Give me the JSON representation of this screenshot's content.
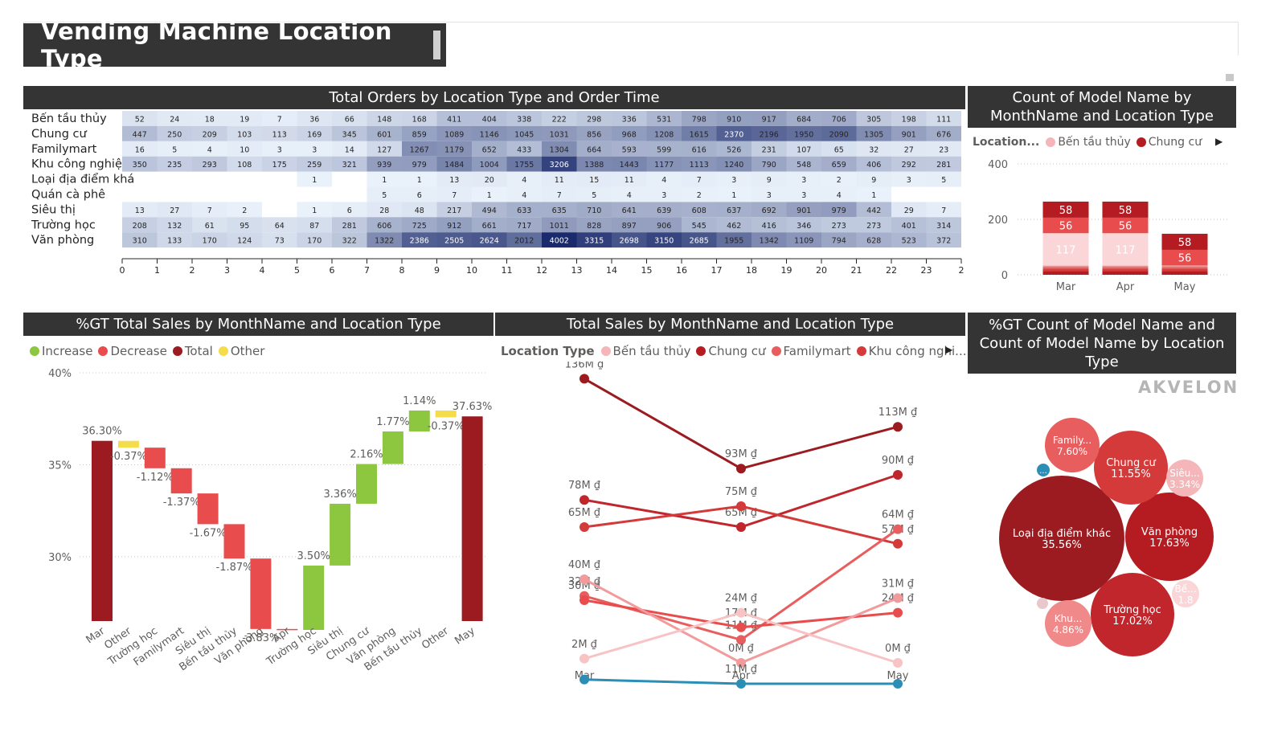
{
  "page": {
    "title": "Vending Machine Location Type",
    "logo": "AKVELON"
  },
  "visuals": {
    "heatmap_title": "Total Orders by Location Type and Order Time",
    "stacked_title": "Count of Model Name by MonthName and Location Type",
    "waterfall_title": "%GT Total Sales by MonthName and Location Type",
    "line_title": "Total Sales by MonthName and Location Type",
    "bubble_title": "%GT Count of Model Name and Count of Model Name by Location Type"
  },
  "colors": {
    "header_bg": "#343434",
    "heat_low": "#eaf2fb",
    "heat_high": "#1a2a6c",
    "increase": "#8dc63f",
    "decrease": "#e84c4c",
    "total": "#9b1b20",
    "other": "#f5dc4a"
  },
  "legends": {
    "stacked": {
      "title": "Location...",
      "items": [
        {
          "label": "Bến tầu thủy",
          "color": "#f4b6b9"
        },
        {
          "label": "Chung cư",
          "color": "#b51c22"
        }
      ]
    },
    "waterfall": {
      "items": [
        {
          "label": "Increase",
          "color": "#8dc63f"
        },
        {
          "label": "Decrease",
          "color": "#e84c4c"
        },
        {
          "label": "Total",
          "color": "#9b1b20"
        },
        {
          "label": "Other",
          "color": "#f5dc4a"
        }
      ]
    },
    "line": {
      "title": "Location Type",
      "items": [
        {
          "label": "Bến tầu thủy",
          "color": "#f4b6b9"
        },
        {
          "label": "Chung cư",
          "color": "#b51c22"
        },
        {
          "label": "Familymart",
          "color": "#e85d5d"
        },
        {
          "label": "Khu công nghi...",
          "color": "#d43a3a"
        }
      ]
    }
  },
  "chart_data": [
    {
      "type": "heatmap",
      "title": "Total Orders by Location Type and Order Time",
      "rows": [
        "Bến tầu thủy",
        "Chung cư",
        "Familymart",
        "Khu công nghiệp",
        "Loại địa điểm khá",
        "Quán cà phê",
        "Siêu thị",
        "Trường học",
        "Văn phòng"
      ],
      "x_ticks": [
        "0",
        "1",
        "2",
        "3",
        "4",
        "5",
        "6",
        "7",
        "8",
        "9",
        "10",
        "11",
        "12",
        "13",
        "14",
        "15",
        "16",
        "17",
        "18",
        "19",
        "20",
        "21",
        "22",
        "23",
        "2"
      ],
      "values": [
        [
          "52",
          "24",
          "18",
          "19",
          "7",
          "36",
          "66",
          "148",
          "168",
          "411",
          "404",
          "338",
          "222",
          "298",
          "336",
          "531",
          "798",
          "910",
          "917",
          "684",
          "706",
          "305",
          "198",
          "111"
        ],
        [
          "447",
          "250",
          "209",
          "103",
          "113",
          "169",
          "345",
          "601",
          "859",
          "1089",
          "1146",
          "1045",
          "1031",
          "856",
          "968",
          "1208",
          "1615",
          "2370",
          "2196",
          "1950",
          "2090",
          "1305",
          "901",
          "676"
        ],
        [
          "16",
          "5",
          "4",
          "10",
          "3",
          "3",
          "14",
          "127",
          "1267",
          "1179",
          "652",
          "433",
          "1304",
          "664",
          "593",
          "599",
          "616",
          "526",
          "231",
          "107",
          "65",
          "32",
          "27",
          "23"
        ],
        [
          "350",
          "235",
          "293",
          "108",
          "175",
          "259",
          "321",
          "939",
          "979",
          "1484",
          "1004",
          "1755",
          "3206",
          "1388",
          "1443",
          "1177",
          "1113",
          "1240",
          "790",
          "548",
          "659",
          "406",
          "292",
          "281"
        ],
        [
          "",
          "",
          "",
          "",
          "",
          "1",
          "",
          "1",
          "1",
          "13",
          "20",
          "4",
          "11",
          "15",
          "11",
          "4",
          "7",
          "3",
          "9",
          "3",
          "2",
          "9",
          "3",
          "5"
        ],
        [
          "",
          "",
          "",
          "",
          "",
          "",
          "",
          "5",
          "6",
          "7",
          "1",
          "4",
          "7",
          "5",
          "4",
          "3",
          "2",
          "1",
          "3",
          "3",
          "4",
          "1",
          "",
          ""
        ],
        [
          "13",
          "27",
          "7",
          "2",
          "",
          "1",
          "6",
          "28",
          "48",
          "217",
          "494",
          "633",
          "635",
          "710",
          "641",
          "639",
          "608",
          "637",
          "692",
          "901",
          "979",
          "442",
          "29",
          "7"
        ],
        [
          "208",
          "132",
          "61",
          "95",
          "64",
          "87",
          "281",
          "606",
          "725",
          "912",
          "661",
          "717",
          "1011",
          "828",
          "897",
          "906",
          "545",
          "462",
          "416",
          "346",
          "273",
          "273",
          "401",
          "314"
        ],
        [
          "310",
          "133",
          "170",
          "124",
          "73",
          "170",
          "322",
          "1322",
          "2386",
          "2505",
          "2624",
          "2012",
          "4002",
          "3315",
          "2698",
          "3150",
          "2685",
          "1955",
          "1342",
          "1109",
          "794",
          "628",
          "523",
          "372"
        ]
      ]
    },
    {
      "type": "bar",
      "stacked": true,
      "title": "Count of Model Name by MonthName and Location Type",
      "categories": [
        "Mar",
        "Apr",
        "May"
      ],
      "y_ticks": [
        "0",
        "200",
        "400"
      ],
      "ylim": [
        0,
        400
      ],
      "series": [
        {
          "color": "#b51c22",
          "values": [
            14,
            14,
            14
          ],
          "labels": [
            "",
            "",
            ""
          ]
        },
        {
          "color": "#d43a3a",
          "values": [
            7,
            7,
            7
          ],
          "labels": [
            "",
            "",
            ""
          ]
        },
        {
          "color": "#e84c4c",
          "values": [
            6,
            6,
            6
          ],
          "labels": [
            "",
            "",
            ""
          ]
        },
        {
          "color": "#f08a8a",
          "values": [
            6,
            6,
            7
          ],
          "labels": [
            "",
            "",
            ""
          ]
        },
        {
          "color": "#fad6d8",
          "values": [
            117,
            117,
            0
          ],
          "labels": [
            "117",
            "117",
            ""
          ]
        },
        {
          "color": "#e84c4c",
          "values": [
            56,
            56,
            56
          ],
          "labels": [
            "56",
            "56",
            "56"
          ]
        },
        {
          "color": "#b51c22",
          "values": [
            58,
            58,
            58
          ],
          "labels": [
            "58",
            "58",
            "58"
          ]
        }
      ]
    },
    {
      "type": "bar",
      "subtype": "waterfall",
      "title": "%GT Total Sales by MonthName and Location Type",
      "y_ticks": [
        "30%",
        "35%",
        "40%"
      ],
      "ylim": [
        26.5,
        40
      ],
      "steps": [
        {
          "label": "Mar",
          "kind": "total",
          "value": 36.3,
          "text": "36.30%"
        },
        {
          "label": "Other",
          "kind": "other",
          "value": -0.37,
          "text": "-0.37%"
        },
        {
          "label": "Trường học",
          "kind": "decrease",
          "value": -1.12,
          "text": "-1.12%"
        },
        {
          "label": "Familymart",
          "kind": "decrease",
          "value": -1.37,
          "text": "-1.37%"
        },
        {
          "label": "Siêu thị",
          "kind": "decrease",
          "value": -1.67,
          "text": "-1.67%"
        },
        {
          "label": "Bến tầu thủy",
          "kind": "decrease",
          "value": -1.87,
          "text": "-1.87%"
        },
        {
          "label": "Văn phòng",
          "kind": "decrease",
          "value": -3.83,
          "text": "-3.83%"
        },
        {
          "label": "Apr",
          "kind": "decrease",
          "value": -0.05,
          "text": ""
        },
        {
          "label": "Trường học",
          "kind": "increase",
          "value": 3.5,
          "text": "3.50%"
        },
        {
          "label": "Siêu thị",
          "kind": "increase",
          "value": 3.36,
          "text": "3.36%"
        },
        {
          "label": "Chung cư",
          "kind": "increase",
          "value": 2.16,
          "text": "2.16%"
        },
        {
          "label": "Văn phòng",
          "kind": "increase",
          "value": 1.77,
          "text": "1.77%"
        },
        {
          "label": "Bến tầu thủy",
          "kind": "increase",
          "value": 1.14,
          "text": "1.14%"
        },
        {
          "label": "Other",
          "kind": "other",
          "value": -0.37,
          "text": "-0.37%"
        },
        {
          "label": "May",
          "kind": "total",
          "value": 37.63,
          "text": "37.63%"
        }
      ]
    },
    {
      "type": "line",
      "title": "Total Sales by MonthName and Location Type",
      "x": [
        "Mar",
        "Apr",
        "May"
      ],
      "series": [
        {
          "color": "#9b1b20",
          "values": [
            136,
            93,
            113
          ],
          "labels": [
            "136M ₫",
            "93M ₫",
            "113M ₫"
          ]
        },
        {
          "color": "#c0262c",
          "values": [
            78,
            65,
            90
          ],
          "labels": [
            "78M ₫",
            "65M ₫",
            "90M ₫"
          ]
        },
        {
          "color": "#d43a3a",
          "values": [
            65,
            75,
            57
          ],
          "labels": [
            "65M ₫",
            "75M ₫",
            "57M ₫"
          ]
        },
        {
          "color": "#e85d5d",
          "values": [
            32,
            11,
            64
          ],
          "labels": [
            "32M ₫",
            "11M ₫",
            "64M ₫"
          ]
        },
        {
          "color": "#e84c4c",
          "values": [
            30,
            17,
            24
          ],
          "labels": [
            "30M ₫",
            "17M ₫",
            "24M ₫"
          ]
        },
        {
          "color": "#f29a9c",
          "values": [
            40,
            0,
            31
          ],
          "labels": [
            "40M ₫",
            "0M ₫",
            "31M ₫"
          ]
        },
        {
          "color": "#f7c3c5",
          "values": [
            2,
            24,
            0
          ],
          "labels": [
            "2M ₫",
            "24M ₫",
            "0M ₫"
          ]
        },
        {
          "color": "#2b8fb5",
          "values": [
            -8,
            -10,
            -10
          ],
          "labels": [
            "",
            "11M ₫",
            ""
          ]
        }
      ]
    },
    {
      "type": "scatter",
      "subtype": "bubble",
      "title": "%GT Count of Model Name and Count of Model Name by Location Type",
      "bubbles": [
        {
          "name": "Loại địa điểm khác",
          "pct": "35.56%",
          "value": 35.56,
          "color": "#9b1b20"
        },
        {
          "name": "Văn phòng",
          "pct": "17.63%",
          "value": 17.63,
          "color": "#b51c22"
        },
        {
          "name": "Trường học",
          "pct": "17.02%",
          "value": 17.02,
          "color": "#c0262c"
        },
        {
          "name": "Chung cư",
          "pct": "11.55%",
          "value": 11.55,
          "color": "#d43a3a"
        },
        {
          "name": "Family...",
          "pct": "7.60%",
          "value": 7.6,
          "color": "#e85d5d"
        },
        {
          "name": "Khu...",
          "pct": "4.86%",
          "value": 4.86,
          "color": "#f08a8a"
        },
        {
          "name": "Siêu...",
          "pct": "3.34%",
          "value": 3.34,
          "color": "#f4b6b9"
        },
        {
          "name": "Bế...",
          "pct": "1.8",
          "value": 1.8,
          "color": "#fad6d8"
        },
        {
          "name": "...",
          "pct": "",
          "value": 0.5,
          "color": "#2b8fb5"
        },
        {
          "name": "",
          "pct": "",
          "value": 0.4,
          "color": "#e8c8ca"
        }
      ]
    }
  ]
}
